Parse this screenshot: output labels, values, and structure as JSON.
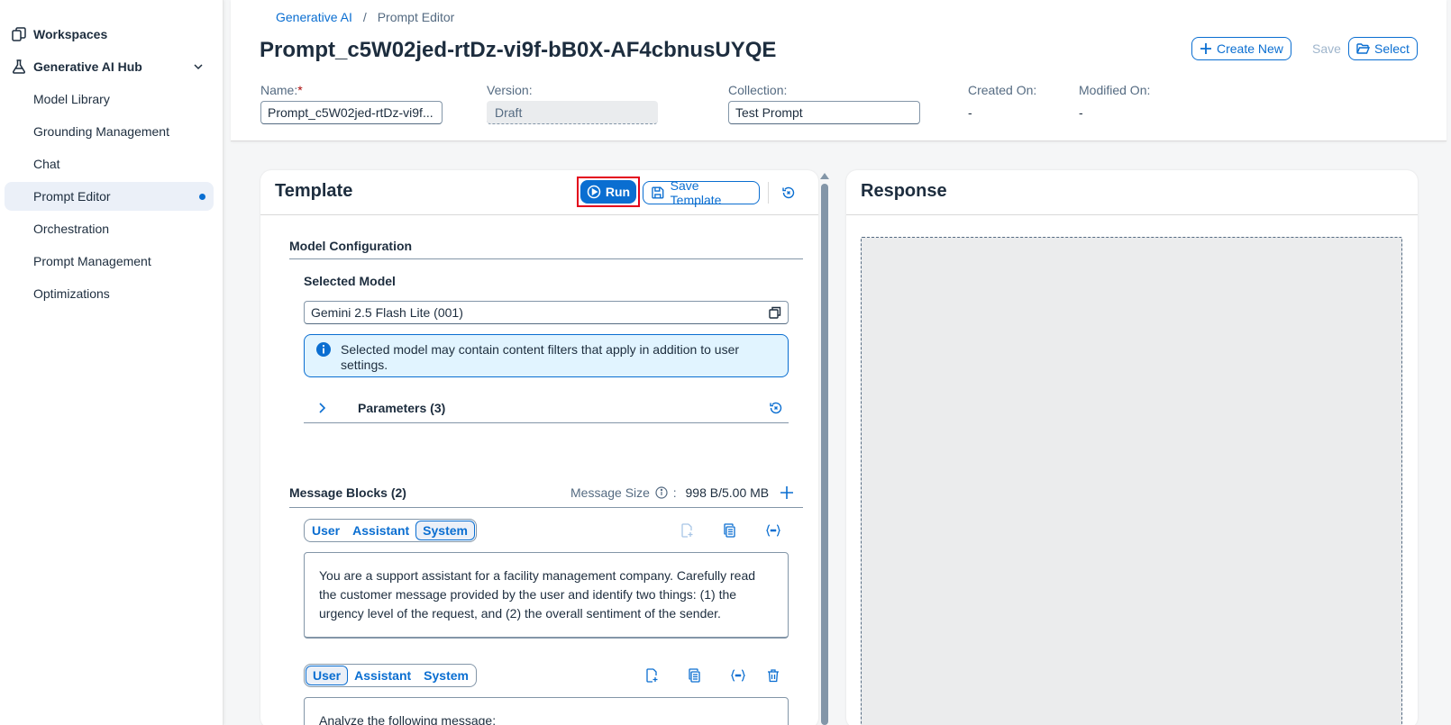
{
  "sidebar": {
    "workspaces": "Workspaces",
    "hub": "Generative AI Hub",
    "items": [
      {
        "label": "Model Library"
      },
      {
        "label": "Grounding Management"
      },
      {
        "label": "Chat"
      },
      {
        "label": "Prompt Editor"
      },
      {
        "label": "Orchestration"
      },
      {
        "label": "Prompt Management"
      },
      {
        "label": "Optimizations"
      }
    ]
  },
  "header": {
    "breadcrumb": [
      "Generative AI",
      "/",
      "Prompt Editor"
    ],
    "title": "Prompt_c5W02jed-rtDz-vi9f-bB0X-AF4cbnusUYQE",
    "buttons": {
      "create_new": "Create New",
      "save": "Save",
      "select": "Select"
    },
    "fields": {
      "name_label": "Name:",
      "name_required": "*",
      "name_value": "Prompt_c5W02jed-rtDz-vi9f...",
      "version_label": "Version:",
      "version_value": "Draft",
      "collection_label": "Collection:",
      "collection_value": "Test Prompt",
      "created_label": "Created On:",
      "created_value": "-",
      "modified_label": "Modified On:",
      "modified_value": "-"
    }
  },
  "template": {
    "title": "Template",
    "run": "Run",
    "save_template": "Save Template",
    "model_config": "Model Configuration",
    "selected_model_label": "Selected Model",
    "selected_model_value": "Gemini 2.5 Flash Lite (001)",
    "info": "Selected model may contain content filters that apply in addition to user settings.",
    "parameters": "Parameters (3)",
    "message_blocks": "Message Blocks (2)",
    "message_size_label": "Message Size",
    "message_size_sep": ":",
    "message_size_value": "998 B/5.00 MB",
    "roles": [
      "User",
      "Assistant",
      "System"
    ],
    "blocks": [
      {
        "selected_role": "System",
        "text": "You are a support assistant for a facility management company. Carefully read the customer message provided by the user and identify two things: (1) the urgency level of the request, and (2) the overall sentiment of the sender."
      },
      {
        "selected_role": "User",
        "text": "Analyze the following message:"
      }
    ]
  },
  "response": {
    "title": "Response"
  },
  "colors": {
    "accent": "#0a6ed1",
    "highlight": "#e3001b",
    "info_bg": "#e1f4ff"
  }
}
